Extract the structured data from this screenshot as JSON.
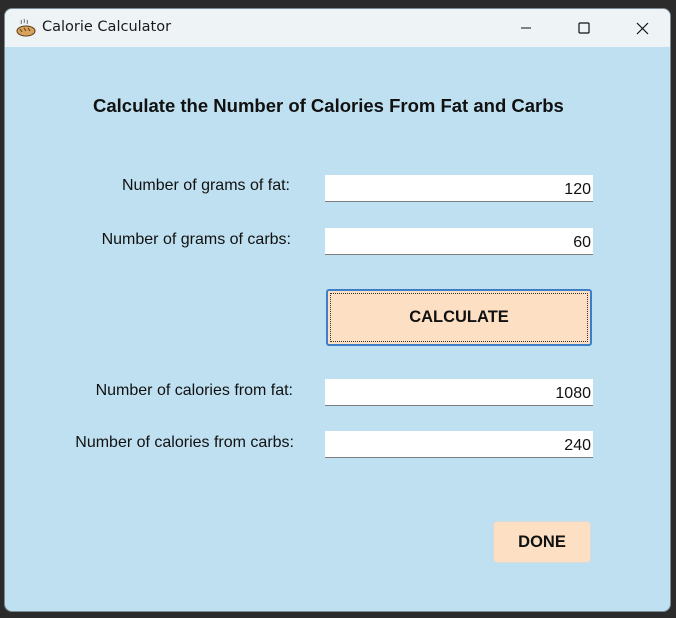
{
  "window": {
    "title": "Calorie Calculator"
  },
  "heading": "Calculate the Number of Calories From Fat and Carbs",
  "inputs": {
    "fat_label": "Number of grams of fat:",
    "fat_value": "120",
    "carbs_label": "Number of grams of carbs:",
    "carbs_value": "60"
  },
  "calculate_label": "CALCULATE",
  "outputs": {
    "fat_cal_label": "Number of calories from fat:",
    "fat_cal_value": "1080",
    "carbs_cal_label": "Number of calories from carbs:",
    "carbs_cal_value": "240"
  },
  "done_label": "DONE",
  "icons": {
    "app": "bread-icon",
    "minimize": "minimize-icon",
    "maximize": "maximize-icon",
    "close": "close-icon"
  },
  "colors": {
    "client_bg": "#bfe0f0",
    "button_bg": "#fde0c3",
    "focus_border": "#3c7fc8"
  }
}
